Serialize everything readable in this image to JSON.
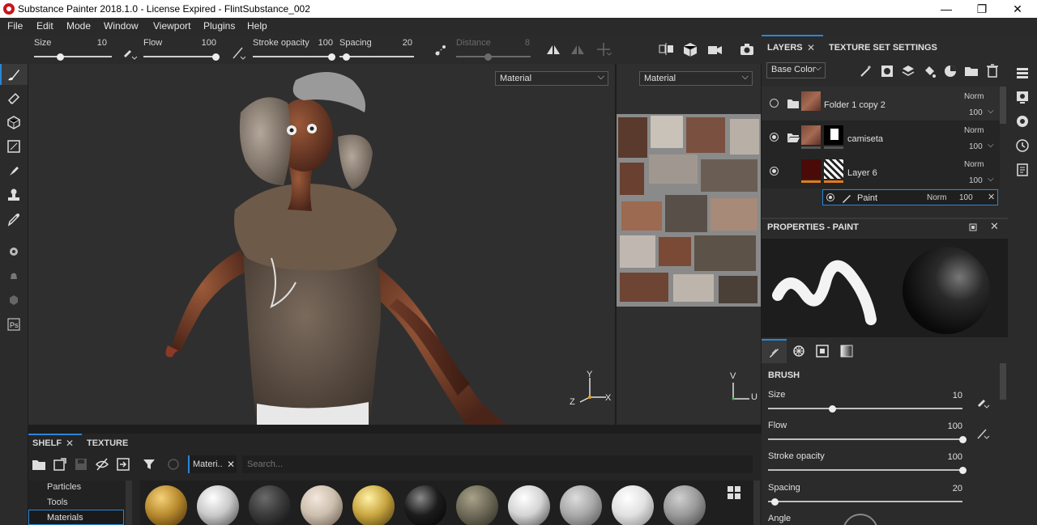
{
  "app": {
    "title": "Substance Painter 2018.1.0 - License Expired - FlintSubstance_002"
  },
  "window_controls": {
    "minimize": "—",
    "maximize": "❐",
    "close": "✕"
  },
  "menu": [
    "File",
    "Edit",
    "Mode",
    "Window",
    "Viewport",
    "Plugins",
    "Help"
  ],
  "toolbar": {
    "size_label": "Size",
    "size_value": "10",
    "flow_label": "Flow",
    "flow_value": "100",
    "stroke_opacity_label": "Stroke opacity",
    "stroke_opacity_value": "100",
    "spacing_label": "Spacing",
    "spacing_value": "20",
    "distance_label": "Distance",
    "distance_value": "8"
  },
  "viewport": {
    "left_mode": "Material",
    "right_mode": "Material",
    "gizmo_3d": {
      "y": "Y",
      "x": "X",
      "z": "Z"
    },
    "gizmo_2d": {
      "v": "V",
      "u": "U"
    }
  },
  "layers_panel": {
    "tab_layers": "LAYERS",
    "tab_texture_set": "TEXTURE SET SETTINGS",
    "channel": "Base Color",
    "layers": [
      {
        "name": "Folder 1 copy 2",
        "blend": "Norm",
        "opacity": "100"
      },
      {
        "name": "camiseta",
        "blend": "Norm",
        "opacity": "100"
      },
      {
        "name": "Layer 6",
        "blend": "Norm",
        "opacity": "100"
      }
    ],
    "effect": {
      "name": "Paint",
      "blend": "Norm",
      "opacity": "100"
    }
  },
  "properties": {
    "title": "PROPERTIES - PAINT",
    "section": "BRUSH",
    "params": [
      {
        "label": "Size",
        "value": "10",
        "level": 0.1
      },
      {
        "label": "Flow",
        "value": "100",
        "level": 1.0
      },
      {
        "label": "Stroke opacity",
        "value": "100",
        "level": 1.0
      },
      {
        "label": "Spacing",
        "value": "20",
        "level": 0.2
      },
      {
        "label": "Angle",
        "value": ""
      }
    ]
  },
  "shelf": {
    "tab_shelf": "SHELF",
    "tab_texture": "TEXTURE",
    "filter_chip": "Materi..",
    "search_placeholder": "Search...",
    "categories": [
      "Particles",
      "Tools",
      "Materials"
    ],
    "selected_category": "Materials",
    "material_colors": [
      "#b98a2e",
      "#c9c9c9",
      "#3a3a3a",
      "#cdbfae",
      "#c9a640",
      "#1c1c1c",
      "#6f6a58",
      "#d4d4d4",
      "#a9a9a9",
      "#e1e1e1",
      "#9a9a9a"
    ]
  },
  "colors": {
    "accent_blue": "#2b86d8",
    "orange_mask": "#e17a1c",
    "panel_bg": "#2b2b2b",
    "viewport_bg": "#2f2f2f"
  }
}
